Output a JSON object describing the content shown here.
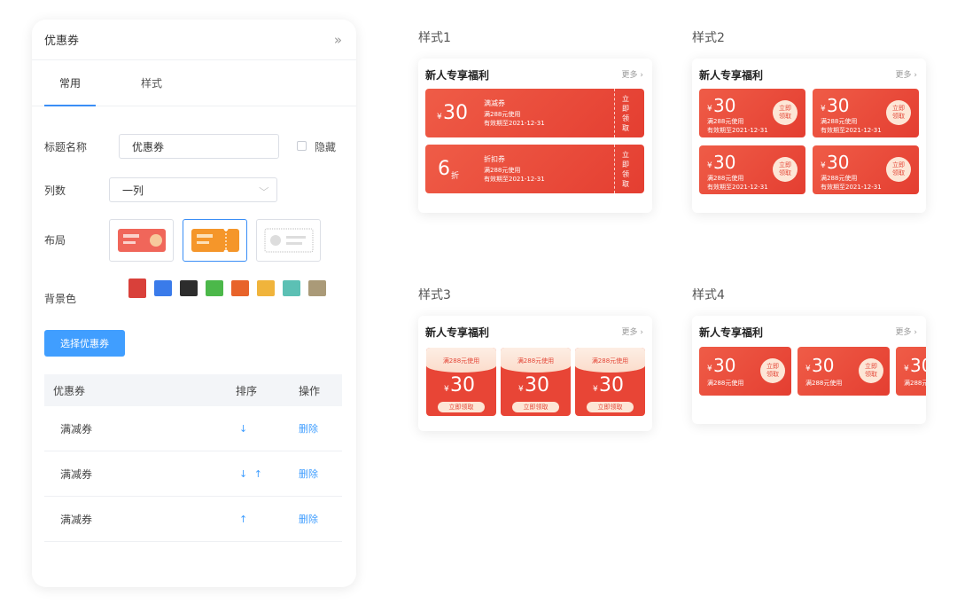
{
  "panel": {
    "title": "优惠券",
    "collapse_icon": "»",
    "tabs": [
      "常用",
      "样式"
    ],
    "title_field": {
      "label": "标题名称",
      "value": "优惠券",
      "hide_label": "隐藏"
    },
    "columns_field": {
      "label": "列数",
      "value": "一列"
    },
    "layout_field": {
      "label": "布局",
      "options": [
        "layout-red-card",
        "layout-orange-ticket",
        "layout-outline-card"
      ],
      "selected": 1
    },
    "bg_field": {
      "label": "背景色",
      "colors": [
        "#d9403a",
        "#3a7bea",
        "#2d2d2d",
        "#4cb84a",
        "#e8632a",
        "#f0b43c",
        "#5cc0b4",
        "#aa9a78"
      ]
    },
    "select_button": "选择优惠券",
    "table": {
      "headers": [
        "优惠券",
        "排序",
        "操作"
      ],
      "rows": [
        {
          "name": "满减券",
          "sort": "↓",
          "action": "删除"
        },
        {
          "name": "满减券",
          "sort": "↓ ↑",
          "action": "删除"
        },
        {
          "name": "满减券",
          "sort": "↑",
          "action": "删除"
        }
      ]
    }
  },
  "previews": {
    "card_title": "新人专享福利",
    "more": "更多 ›",
    "style1": {
      "label": "样式1",
      "coupons": [
        {
          "value": "30",
          "prefix": "¥",
          "name": "满减券",
          "cond": "满288元使用",
          "expiry": "有效期至2021-12-31",
          "action": "立即领取"
        },
        {
          "value": "6",
          "suffix": "折",
          "name": "折扣券",
          "cond": "满288元使用",
          "expiry": "有效期至2021-12-31",
          "action": "立即领取"
        }
      ]
    },
    "style2": {
      "label": "样式2",
      "coupon": {
        "prefix": "¥",
        "value": "30",
        "cond": "满288元使用",
        "expiry": "有效期至2021-12-31",
        "action": "立即领取"
      }
    },
    "style3": {
      "label": "样式3",
      "coupon": {
        "cond": "满288元使用",
        "prefix": "¥",
        "value": "30",
        "action": "立即领取"
      }
    },
    "style4": {
      "label": "样式4",
      "coupon": {
        "prefix": "¥",
        "value": "30",
        "cond": "满288元使用",
        "action": "立即领取"
      }
    }
  }
}
